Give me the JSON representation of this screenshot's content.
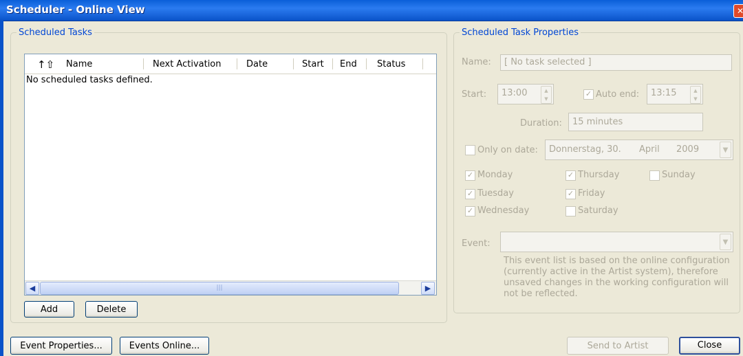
{
  "window": {
    "title": "Scheduler - Online View"
  },
  "tasks": {
    "legend": "Scheduled Tasks",
    "columns": [
      "Name",
      "Next Activation",
      "Date",
      "Start",
      "End",
      "Status"
    ],
    "empty_message": "No scheduled tasks defined.",
    "add_label": "Add",
    "delete_label": "Delete"
  },
  "props": {
    "legend": "Scheduled Task Properties",
    "name_label": "Name:",
    "name_value": "[ No task selected ]",
    "start_label": "Start:",
    "start_value": "13:00",
    "auto_end_label": "Auto end:",
    "auto_end_checked": true,
    "end_value": "13:15",
    "duration_label": "Duration:",
    "duration_value": "15 minutes",
    "only_on_date_label": "Only on date:",
    "only_on_date_checked": false,
    "date_value": {
      "weekday_day": "Donnerstag, 30.",
      "month": "April",
      "year": "2009"
    },
    "days": [
      {
        "label": "Monday",
        "checked": true
      },
      {
        "label": "Tuesday",
        "checked": true
      },
      {
        "label": "Wednesday",
        "checked": true
      },
      {
        "label": "Thursday",
        "checked": true
      },
      {
        "label": "Friday",
        "checked": true
      },
      {
        "label": "Saturday",
        "checked": false
      },
      {
        "label": "Sunday",
        "checked": false
      }
    ],
    "event_label": "Event:",
    "event_value": "",
    "event_note": "This event list is based on the online configuration (currently active in the Artist system), therefore unsaved changes in the working configuration will not be reflected."
  },
  "footer": {
    "event_properties_label": "Event Properties...",
    "events_online_label": "Events Online...",
    "send_to_artist_label": "Send to Artist",
    "close_label": "Close"
  },
  "colors": {
    "titlebar": "#0a5fd8",
    "legend": "#0046d5",
    "disabled_text": "#aca899",
    "background": "#ece9d8"
  }
}
